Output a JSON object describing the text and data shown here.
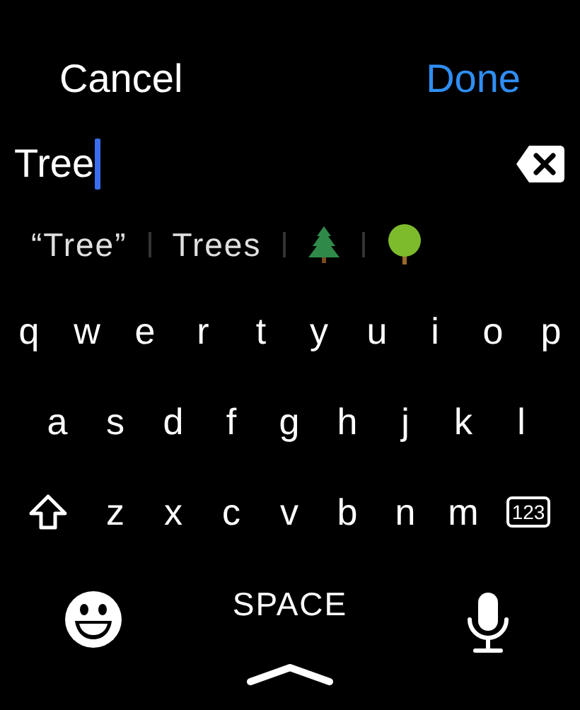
{
  "header": {
    "cancel": "Cancel",
    "done": "Done"
  },
  "field": {
    "value": "Tree"
  },
  "suggestions": [
    {
      "kind": "text",
      "label": "“Tree”"
    },
    {
      "kind": "text",
      "label": "Trees"
    },
    {
      "kind": "evergreen"
    },
    {
      "kind": "deciduous"
    }
  ],
  "rows": [
    [
      "q",
      "w",
      "e",
      "r",
      "t",
      "y",
      "u",
      "i",
      "o",
      "p"
    ],
    [
      "a",
      "s",
      "d",
      "f",
      "g",
      "h",
      "j",
      "k",
      "l"
    ],
    [
      "z",
      "x",
      "c",
      "v",
      "b",
      "n",
      "m"
    ]
  ],
  "number_key": "123",
  "space_key": "SPACE"
}
